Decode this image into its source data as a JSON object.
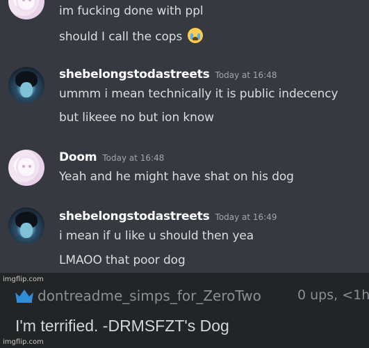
{
  "messages": [
    {
      "author": "",
      "timestamp": "",
      "lines": [
        "im fucking done with ppl",
        "should I call the cops"
      ],
      "emoji": "loudly-crying-face"
    },
    {
      "author": "shebelongstodastreets",
      "timestamp": "Today at 16:48",
      "lines": [
        "ummm i mean technically it is public indecency",
        "but likeee no but ion know"
      ]
    },
    {
      "author": "Doom",
      "timestamp": "Today at 16:48",
      "lines": [
        "Yeah and he might have shat on his dog"
      ]
    },
    {
      "author": "shebelongstodastreets",
      "timestamp": "Today at 16:49",
      "lines": [
        "i mean if u like u should then yea",
        "LMAOO that poor dog"
      ]
    }
  ],
  "watermarks": [
    "imgflip.com",
    "imgflip.com"
  ],
  "comment": {
    "username": "dontreadme_simps_for_ZeroTwo",
    "meta": "0 ups, <1h",
    "text": "I'm terrified. -DRMSFZT's Dog",
    "badge_icon": "crown-icon"
  },
  "colors": {
    "chat_background": "#36393f",
    "comment_background": "#222426",
    "badge": "#2e8fd8"
  }
}
